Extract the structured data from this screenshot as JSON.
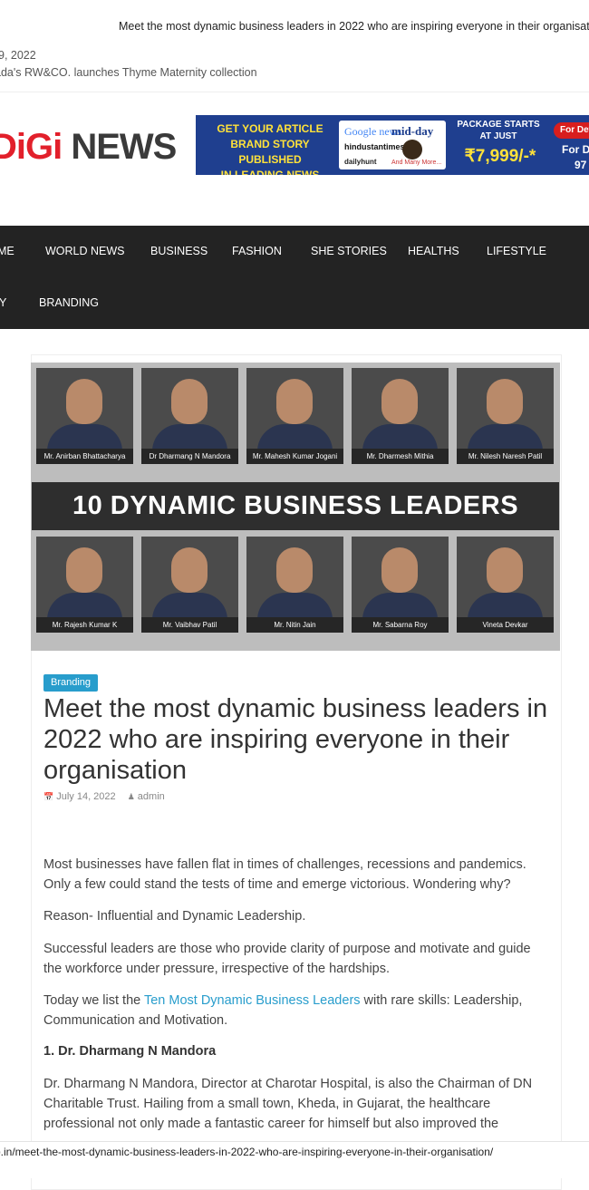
{
  "ticker": {
    "headline": "Meet the most dynamic business leaders in 2022 who are inspiring everyone in their organisation",
    "date": "9, 2022",
    "news": "ada's RW&CO. launches Thyme Maternity collection"
  },
  "logo": {
    "part1": "DiGi",
    "part2": " NEWS"
  },
  "ad": {
    "line1": "GET YOUR ARTICLE",
    "line2": "BRAND STORY PUBLISHED",
    "line3": "IN LEADING NEWS PORTAL'S",
    "google": "Google news",
    "midday": "mid-day",
    "ht": "hindustantimes",
    "dailyhunt": "dailyhunt",
    "more": "And Many More...",
    "package": "PACKAGE STARTS AT JUST",
    "price": "₹7,999/-*",
    "details": "For Det",
    "f1": "For D",
    "f2": "97"
  },
  "nav": {
    "items": [
      "ME",
      "WORLD NEWS",
      "BUSINESS",
      "FASHION",
      "SHE STORIES",
      "HEALTHS",
      "LIFESTYLE",
      "Y",
      "BRANDING"
    ]
  },
  "featured": {
    "banner": "10 DYNAMIC BUSINESS LEADERS",
    "names": [
      "Mr. Anirban Bhattacharya",
      "Dr Dharmang N Mandora",
      "Mr. Mahesh Kumar Jogani",
      "Mr. Dharmesh Mithia",
      "Mr. Nilesh Naresh Patil",
      "Mr. Rajesh Kumar K",
      "Mr. Vaibhav Patil",
      "Mr. Nitin Jain",
      "Mr. Sabarna Roy",
      "Vineta Devkar"
    ]
  },
  "article": {
    "category": "Branding",
    "title": "Meet the most dynamic business leaders in 2022 who are inspiring everyone in their organisation",
    "date": "July 14, 2022",
    "author": "admin",
    "p1": "Most businesses have fallen flat in times of challenges, recessions and pandemics. Only a few could stand the tests of time and emerge victorious. Wondering why?",
    "p2": "Reason- Influential and Dynamic Leadership.",
    "p3": "Successful leaders are those who provide clarity of purpose and motivate and guide the workforce under pressure, irrespective of the hardships.",
    "p4_pre": "Today we list the ",
    "p4_link": "Ten Most Dynamic Business Leaders",
    "p4_post": " with rare skills: Leadership, Communication and Motivation.",
    "h1": "1. Dr. Dharmang N Mandora",
    "p5": "Dr. Dharmang N Mandora, Director at Charotar Hospital, is also the Chairman of DN Charitable Trust. Hailing from a small town, Kheda, in Gujarat, the healthcare professional not only made a fantastic career for himself but also improved the"
  },
  "status_url": "o.in/meet-the-most-dynamic-business-leaders-in-2022-who-are-inspiring-everyone-in-their-organisation/"
}
